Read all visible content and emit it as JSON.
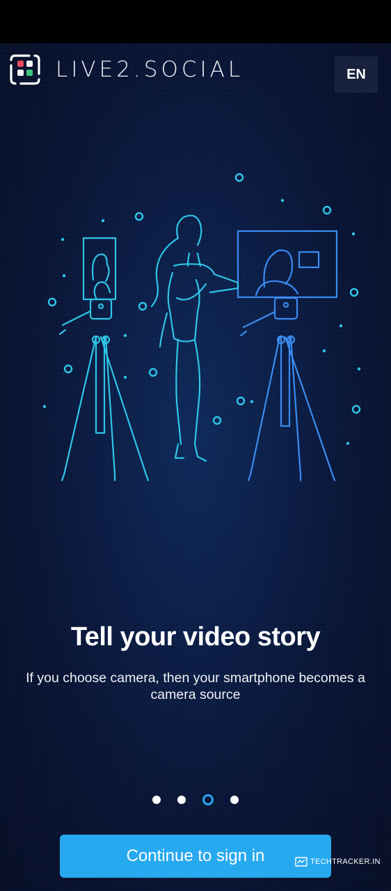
{
  "header": {
    "logo_text": "LIVE2.SOCIAL",
    "language_label": "EN"
  },
  "onboarding": {
    "title": "Tell your video story",
    "subtitle": "If you choose camera, then your smartphone becomes a camera source",
    "page_count": 4,
    "active_page": 3
  },
  "actions": {
    "continue_label": "Continue to sign in"
  },
  "watermark": {
    "text": "TECHTRACKER.IN"
  },
  "colors": {
    "accent": "#27a9ef",
    "background": "#0c1d44",
    "line_art": "#2fc6e8",
    "line_art_secondary": "#3a8cf0"
  },
  "icons": {
    "logo": "app-logo-icon",
    "illustration": "camera-setup-illustration"
  }
}
